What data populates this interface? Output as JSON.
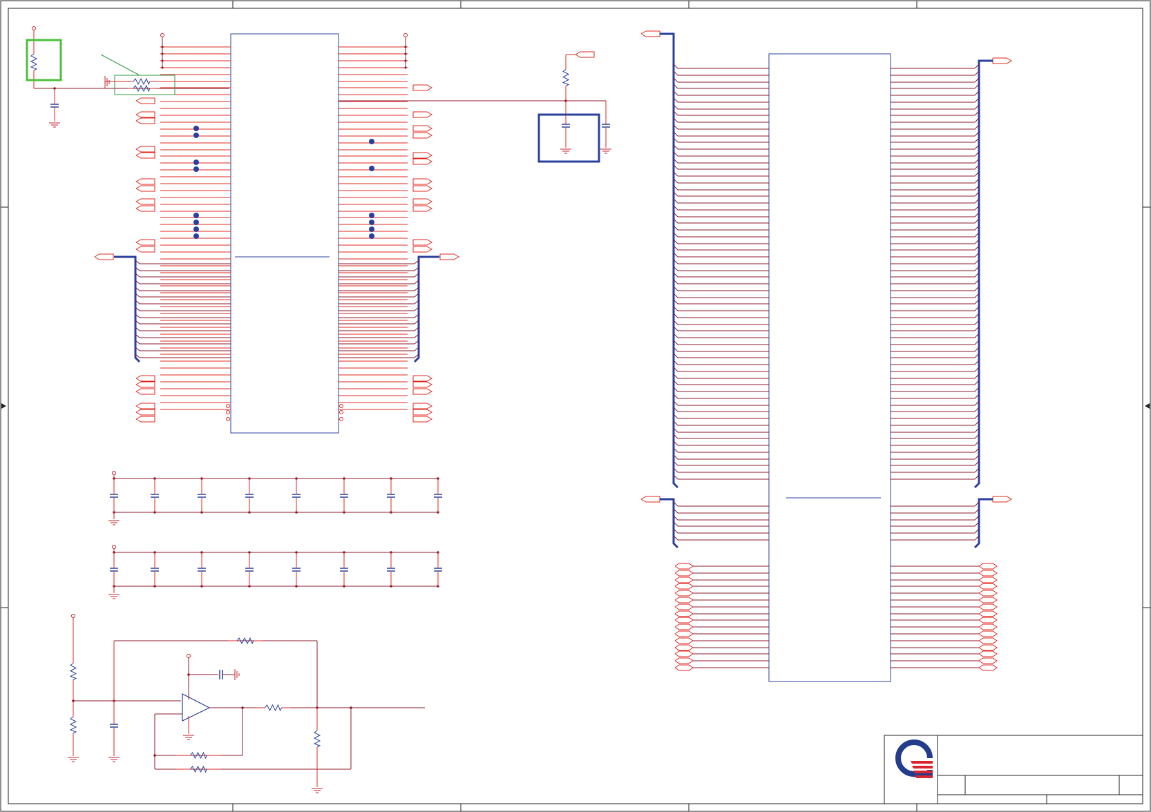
{
  "sheet": {
    "background": "#ffffff",
    "border_color": "#222222",
    "wire_color": "#e2241b",
    "net_color": "#8b1a2b",
    "component_color": "#2b3f9c",
    "bus_color": "#2b3f9c",
    "power_color": "#c0202a",
    "highlight_color": "#4cbf3a",
    "logo_blue": "#243c8c",
    "logo_red": "#d7262f"
  },
  "title_block": {
    "logo_name": "company-logo",
    "title": "",
    "sheet_label": "",
    "revision": ""
  }
}
